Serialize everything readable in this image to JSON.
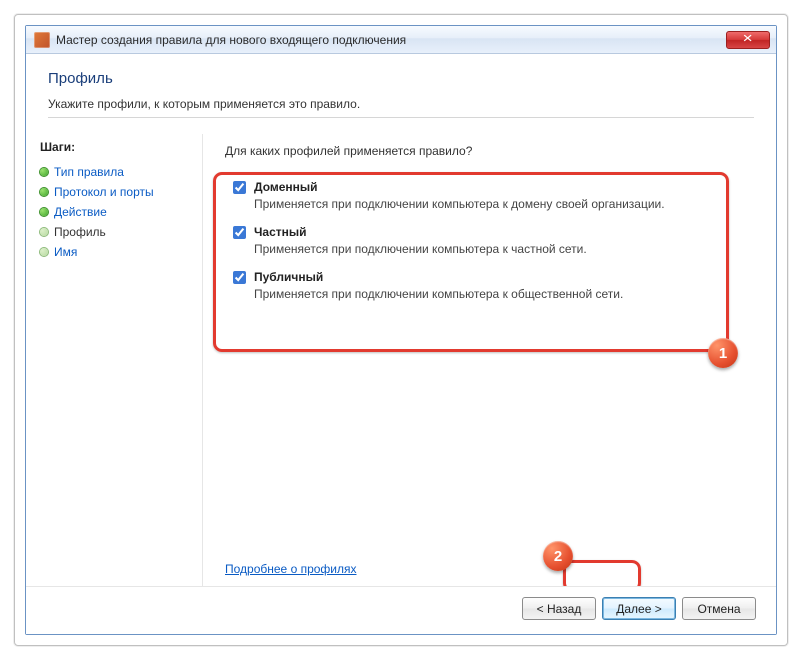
{
  "window": {
    "title": "Мастер создания правила для нового входящего подключения"
  },
  "header": {
    "title": "Профиль",
    "subtitle": "Укажите профили, к которым применяется это правило."
  },
  "sidebar": {
    "heading": "Шаги:",
    "items": [
      {
        "label": "Тип правила",
        "state": "done",
        "link": true
      },
      {
        "label": "Протокол и порты",
        "state": "done",
        "link": true
      },
      {
        "label": "Действие",
        "state": "done",
        "link": true
      },
      {
        "label": "Профиль",
        "state": "pend",
        "link": false
      },
      {
        "label": "Имя",
        "state": "pend",
        "link": true
      }
    ]
  },
  "main": {
    "question": "Для каких профилей применяется правило?",
    "options": [
      {
        "name": "Доменный",
        "desc": "Применяется при подключении компьютера к домену своей организации.",
        "checked": true
      },
      {
        "name": "Частный",
        "desc": "Применяется при подключении компьютера к частной сети.",
        "checked": true
      },
      {
        "name": "Публичный",
        "desc": "Применяется при подключении компьютера к общественной сети.",
        "checked": true
      }
    ],
    "learn_more": "Подробнее о профилях"
  },
  "footer": {
    "back": "< Назад",
    "next": "Далее >",
    "cancel": "Отмена"
  },
  "annotations": {
    "badge1": "1",
    "badge2": "2"
  }
}
